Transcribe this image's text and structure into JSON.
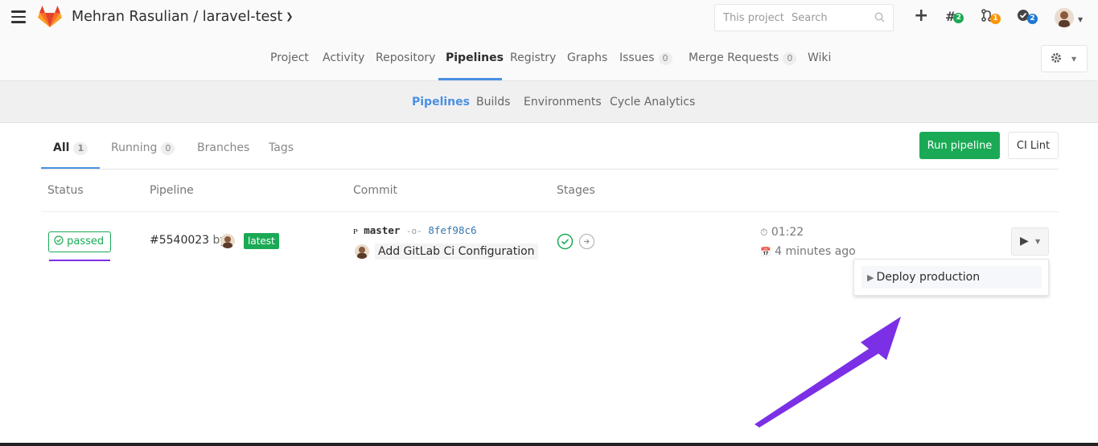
{
  "header": {
    "project_path": "Mehran Rasulian / laravel-test",
    "search_scope": "This project",
    "search_placeholder": "Search",
    "todo_count": "2",
    "merge_request_count": "1",
    "issues_count": "2",
    "icons": [
      "hamburger-icon",
      "gitlab-logo",
      "plus-icon",
      "search-icon",
      "todo-icon",
      "merge-request-icon",
      "issues-icon",
      "avatar"
    ],
    "colors": {
      "todo": "#1aaa55",
      "merge_request": "#fc9403",
      "issues": "#1f78d1"
    }
  },
  "project_nav": {
    "items": [
      {
        "label": "Project"
      },
      {
        "label": "Activity"
      },
      {
        "label": "Repository"
      },
      {
        "label": "Pipelines",
        "active": true
      },
      {
        "label": "Registry"
      },
      {
        "label": "Graphs"
      },
      {
        "label": "Issues",
        "count": "0"
      },
      {
        "label": "Merge Requests",
        "count": "0"
      },
      {
        "label": "Wiki"
      }
    ]
  },
  "sub_nav": {
    "items": [
      {
        "label": "Pipelines",
        "active": true
      },
      {
        "label": "Builds"
      },
      {
        "label": "Environments"
      },
      {
        "label": "Cycle Analytics"
      }
    ]
  },
  "scope_tabs": {
    "items": [
      {
        "label": "All",
        "count": "1",
        "active": true
      },
      {
        "label": "Running",
        "count": "0"
      },
      {
        "label": "Branches"
      },
      {
        "label": "Tags"
      }
    ],
    "run_pipeline_label": "Run pipeline",
    "ci_lint_label": "CI Lint"
  },
  "table": {
    "headers": [
      "Status",
      "Pipeline",
      "Commit",
      "Stages"
    ],
    "rows": [
      {
        "status": "passed",
        "pipeline_id": "#5540023",
        "by": "by",
        "tag": "latest",
        "branch": "master",
        "sha": "8fef98c6",
        "commit_title": "Add GitLab Ci Configuration",
        "duration": "01:22",
        "finished": "4 minutes ago"
      }
    ]
  },
  "dropdown": {
    "items": [
      {
        "label": "Deploy production"
      }
    ]
  },
  "accent_colors": {
    "green": "#1aaa55",
    "blue": "#4a90e2",
    "annotation": "#7b30e6"
  }
}
